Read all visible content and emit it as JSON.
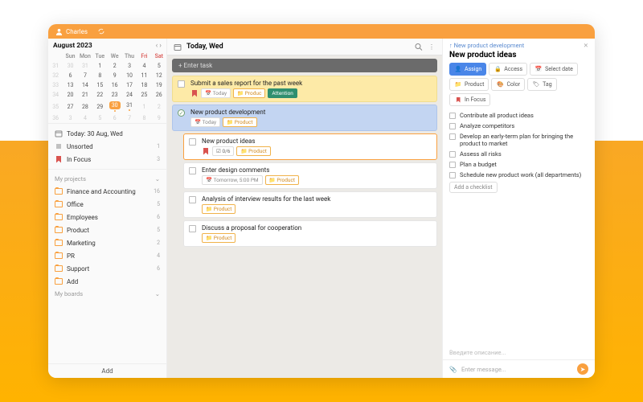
{
  "topbar": {
    "user": "Charles"
  },
  "calendar": {
    "month": "August 2023",
    "dow": [
      "Sun",
      "Mon",
      "Tue",
      "We",
      "Thu",
      "Fri",
      "Sat"
    ],
    "weeks": [
      {
        "n": "31",
        "days": [
          {
            "d": "30",
            "dim": true
          },
          {
            "d": "31",
            "dim": true
          },
          {
            "d": "1"
          },
          {
            "d": "2"
          },
          {
            "d": "3"
          },
          {
            "d": "4"
          },
          {
            "d": "5"
          }
        ]
      },
      {
        "n": "32",
        "days": [
          {
            "d": "6"
          },
          {
            "d": "7"
          },
          {
            "d": "8"
          },
          {
            "d": "9"
          },
          {
            "d": "10"
          },
          {
            "d": "11"
          },
          {
            "d": "12"
          }
        ]
      },
      {
        "n": "33",
        "days": [
          {
            "d": "13"
          },
          {
            "d": "14"
          },
          {
            "d": "15"
          },
          {
            "d": "16"
          },
          {
            "d": "17"
          },
          {
            "d": "18"
          },
          {
            "d": "19"
          }
        ]
      },
      {
        "n": "34",
        "days": [
          {
            "d": "20"
          },
          {
            "d": "21"
          },
          {
            "d": "22"
          },
          {
            "d": "23"
          },
          {
            "d": "24"
          },
          {
            "d": "25"
          },
          {
            "d": "26"
          }
        ]
      },
      {
        "n": "35",
        "days": [
          {
            "d": "27"
          },
          {
            "d": "28"
          },
          {
            "d": "29"
          },
          {
            "d": "30",
            "today": true,
            "dot": true
          },
          {
            "d": "31",
            "dot": true
          },
          {
            "d": "1",
            "dim": true
          },
          {
            "d": "2",
            "dim": true
          }
        ]
      },
      {
        "n": "36",
        "days": [
          {
            "d": "3",
            "dim": true
          },
          {
            "d": "4",
            "dim": true
          },
          {
            "d": "5",
            "dim": true
          },
          {
            "d": "6",
            "dim": true
          },
          {
            "d": "7",
            "dim": true
          },
          {
            "d": "8",
            "dim": true
          },
          {
            "d": "9",
            "dim": true
          }
        ]
      }
    ]
  },
  "side": {
    "today": {
      "label": "Today: 30 Aug, Wed"
    },
    "unsorted": {
      "label": "Unsorted",
      "count": "1"
    },
    "infocus": {
      "label": "In Focus",
      "count": "3"
    },
    "projects_label": "My projects",
    "projects": [
      {
        "label": "Finance and Accounting",
        "count": "16"
      },
      {
        "label": "Office",
        "count": "5"
      },
      {
        "label": "Employees",
        "count": "6"
      },
      {
        "label": "Product",
        "count": "5"
      },
      {
        "label": "Marketing",
        "count": "2"
      },
      {
        "label": "PR",
        "count": "4"
      },
      {
        "label": "Support",
        "count": "6"
      },
      {
        "label": "Add",
        "count": ""
      }
    ],
    "boards_label": "My boards",
    "add": "Add"
  },
  "center": {
    "title": "Today, Wed",
    "enter": "+ Enter task",
    "tasks": [
      {
        "style": "yellow",
        "title": "Submit a sales report for the past week",
        "chips": [
          {
            "t": "bookmark"
          },
          {
            "t": "date",
            "v": "Today"
          },
          {
            "t": "prod",
            "v": "Produc"
          },
          {
            "t": "att",
            "v": "Attention"
          }
        ]
      },
      {
        "style": "blue",
        "done": true,
        "title": "New product development",
        "chips": [
          {
            "t": "date",
            "v": "Today"
          },
          {
            "t": "prod",
            "v": "Product"
          }
        ],
        "subs": [
          {
            "sel": true,
            "title": "New product ideas",
            "chips": [
              {
                "t": "bookmark"
              },
              {
                "t": "count",
                "v": "0/6"
              },
              {
                "t": "prod",
                "v": "Product"
              }
            ]
          },
          {
            "title": "Enter design comments",
            "chips": [
              {
                "t": "date",
                "v": "Tomorrow, 5:00 PM"
              },
              {
                "t": "prod",
                "v": "Product"
              }
            ]
          },
          {
            "title": "Analysis of interview results for the last week",
            "chips": [
              {
                "t": "prod",
                "v": "Product"
              }
            ]
          },
          {
            "title": "Discuss a proposal for cooperation",
            "chips": [
              {
                "t": "prod",
                "v": "Product"
              }
            ]
          }
        ]
      }
    ]
  },
  "details": {
    "breadcrumb": "New product development",
    "title": "New product ideas",
    "pills1": [
      {
        "cls": "assign",
        "icon": "user",
        "label": "Assign"
      },
      {
        "icon": "lock",
        "label": "Access"
      },
      {
        "icon": "cal",
        "label": "Select date"
      }
    ],
    "pills2": [
      {
        "icon": "folder",
        "label": "Product"
      },
      {
        "icon": "color",
        "label": "Color"
      },
      {
        "icon": "tag",
        "label": "Tag"
      }
    ],
    "pills3": [
      {
        "icon": "bookmark",
        "label": "In Focus"
      }
    ],
    "checks": [
      "Contribute all product ideas",
      "Analyze competitors",
      "Develop an early-term plan for bringing the product to market",
      "Assess all risks",
      "Plan a budget",
      "Schedule new product work (all departments)"
    ],
    "add_checklist": "Add a checklist",
    "desc_placeholder": "Введите описание...",
    "msg_placeholder": "Enter message..."
  }
}
